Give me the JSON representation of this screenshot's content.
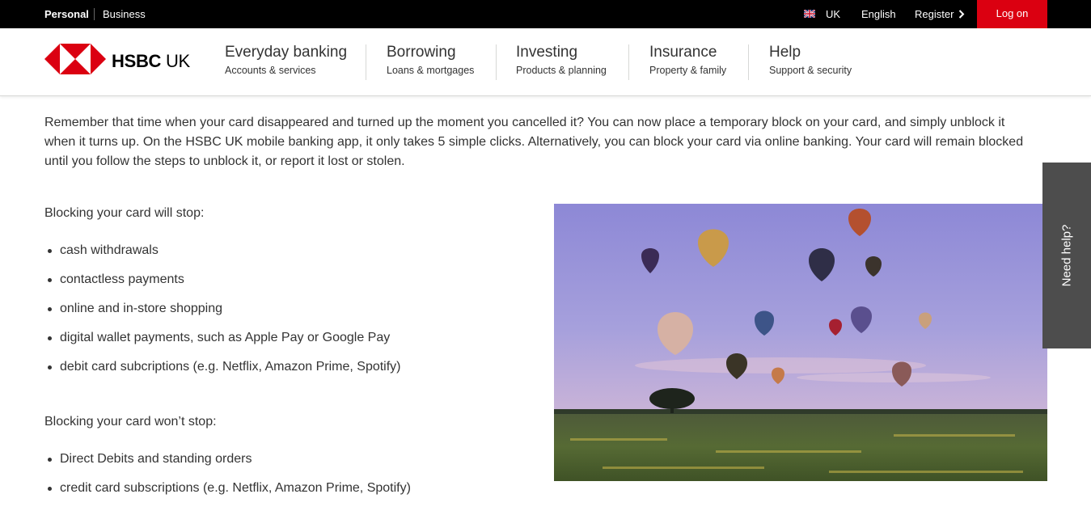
{
  "topbar": {
    "personal": "Personal",
    "business": "Business",
    "country": "UK",
    "language": "English",
    "register": "Register",
    "login": "Log on"
  },
  "brand": {
    "name_bold": "HSBC",
    "name_regular": "UK",
    "color": "#db0011"
  },
  "nav": [
    {
      "title": "Everyday banking",
      "sub": "Accounts & services"
    },
    {
      "title": "Borrowing",
      "sub": "Loans & mortgages"
    },
    {
      "title": "Investing",
      "sub": "Products & planning"
    },
    {
      "title": "Insurance",
      "sub": "Property & family"
    },
    {
      "title": "Help",
      "sub": "Support & security"
    }
  ],
  "content": {
    "intro": "Remember that time when your card disappeared and turned up the moment you cancelled it? You can now place a temporary block on your card, and simply unblock it when it turns up. On the HSBC UK mobile banking app, it only takes 5 simple clicks. Alternatively, you can block your card via online banking. Your card will remain blocked until you follow the steps to unblock it, or report it lost or stolen.",
    "will_stop_heading": "Blocking your card will stop:",
    "will_stop": [
      "cash withdrawals",
      "contactless payments",
      "online and in-store shopping",
      "digital wallet payments, such as Apple Pay or Google Pay",
      "debit card subcriptions (e.g. Netflix, Amazon Prime, Spotify)"
    ],
    "wont_stop_heading": "Blocking your card won’t stop:",
    "wont_stop": [
      "Direct Debits and standing orders",
      "credit card subscriptions (e.g. Netflix, Amazon Prime, Spotify)"
    ]
  },
  "help_tab": {
    "label": "Need help?"
  },
  "colors": {
    "accent": "#db0011",
    "topbar_bg": "#000000",
    "help_bg": "#4d4d4d"
  }
}
